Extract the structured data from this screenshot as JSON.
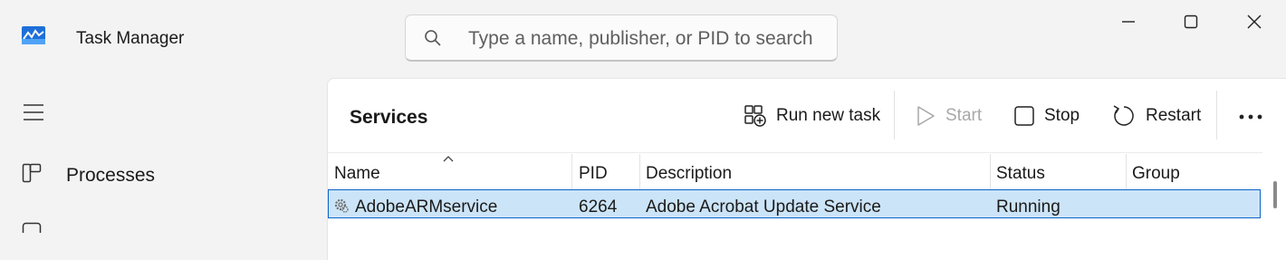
{
  "window": {
    "title": "Task Manager",
    "icon": "task-manager-app-icon",
    "controls": [
      "minimize-icon",
      "maximize-icon",
      "close-icon"
    ]
  },
  "search": {
    "placeholder": "Type a name, publisher, or PID to search"
  },
  "nav": {
    "menu_icon": "hamburger-icon",
    "items": [
      {
        "label": "Processes",
        "icon": "processes-icon"
      }
    ]
  },
  "page": {
    "title": "Services"
  },
  "toolbar": {
    "run_new_task": "Run new task",
    "start": "Start",
    "stop": "Stop",
    "restart": "Restart",
    "more_icon": "more-icon"
  },
  "table": {
    "columns": [
      "Name",
      "PID",
      "Description",
      "Status",
      "Group"
    ],
    "sorted_column": "Name",
    "rows": [
      {
        "name": "AdobeARMservice",
        "pid": "6264",
        "description": "Adobe Acrobat Update Service",
        "status": "Running",
        "group": "",
        "selected": true
      }
    ]
  },
  "colors": {
    "window_bg": "#f3f3f3",
    "panel_bg": "#ffffff",
    "selection_bg": "#cce4f7",
    "selection_border": "#0a64c8"
  }
}
